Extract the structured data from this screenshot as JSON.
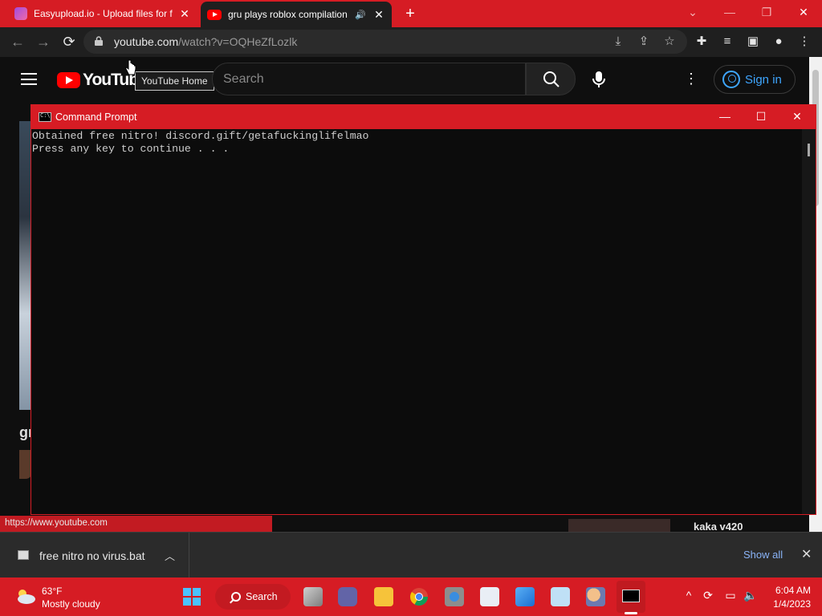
{
  "browser": {
    "tabs": [
      {
        "title": "Easyupload.io - Upload files for f",
        "close": "✕"
      },
      {
        "title": "gru plays roblox compilation",
        "close": "✕"
      }
    ],
    "new_tab": "+",
    "window_controls": {
      "minimize": "—",
      "maximize": "❐",
      "close": "✕"
    },
    "url_host": "youtube.com",
    "url_path": "/watch?v=OQHeZfLozlk"
  },
  "youtube": {
    "logo_text": "YouTube",
    "tooltip": "YouTube Home",
    "search_placeholder": "Search",
    "sign_in": "Sign in",
    "title_fragment": "gı",
    "sidebar_card_title": "kaka v420"
  },
  "cmd": {
    "title": "Command Prompt",
    "lines": [
      "Obtained free nitro! discord.gift/getafuckinglifelmao",
      "Press any key to continue . . ."
    ]
  },
  "status_url": "https://www.youtube.com",
  "downloads": {
    "file": "free nitro no virus.bat",
    "show_all": "Show all",
    "close": "✕"
  },
  "taskbar": {
    "temperature": "63°F",
    "condition": "Mostly cloudy",
    "search_label": "Search",
    "time": "6:04 AM",
    "date": "1/4/2023"
  },
  "colors": {
    "accent_red": "#d61c24",
    "youtube_red": "#ff0000",
    "link_blue": "#3ea6ff"
  }
}
